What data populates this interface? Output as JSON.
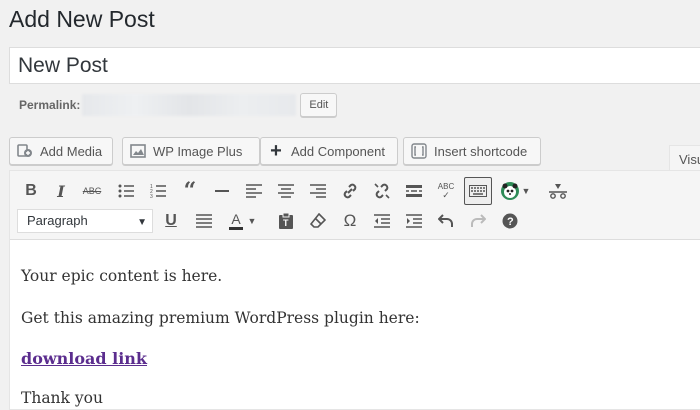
{
  "header": {
    "title": "Add New Post"
  },
  "post": {
    "title_value": "New Post",
    "permalink_label": "Permalink:",
    "edit_label": "Edit"
  },
  "media_buttons": [
    {
      "label": "Add Media",
      "icon": "add-media-icon"
    },
    {
      "label": "WP Image Plus",
      "icon": "image-icon"
    },
    {
      "label": "Add Component",
      "icon": "plus-icon"
    },
    {
      "label": "Insert shortcode",
      "icon": "shortcode-icon"
    }
  ],
  "editor_tabs": {
    "visual_label": "Visu"
  },
  "toolbar": {
    "row1": [
      "bold-icon",
      "italic-icon",
      "strikethrough-icon",
      "bulleted-list-icon",
      "numbered-list-icon",
      "blockquote-icon",
      "horizontal-line-icon",
      "align-left-icon",
      "align-center-icon",
      "align-right-icon",
      "link-icon",
      "unlink-icon",
      "read-more-icon",
      "spellcheck-icon",
      "toolbar-toggle-icon",
      "panda-icon",
      "dropdown-caret-icon",
      "strike-hammer-icon"
    ],
    "row2": [
      "format-select",
      "underline-icon",
      "justify-icon",
      "text-color-icon",
      "text-color-caret-icon",
      "paste-as-text-icon",
      "clear-formatting-icon",
      "special-character-icon",
      "outdent-icon",
      "indent-icon",
      "undo-icon",
      "redo-icon",
      "help-icon"
    ],
    "format_select_value": "Paragraph"
  },
  "content": {
    "line1": "Your epic content is here.",
    "line2": "Get this amazing premium WordPress plugin here:",
    "link_text": "download link",
    "line4": "Thank you"
  },
  "colors": {
    "link": "#5b2d8e",
    "toolbar_bg": "#f5f5f5",
    "page_bg": "#f1f1f1"
  }
}
